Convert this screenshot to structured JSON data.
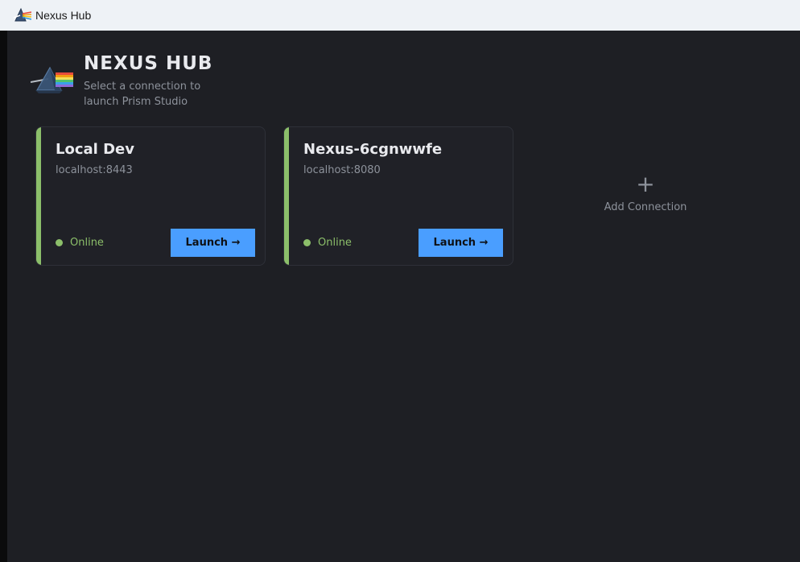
{
  "window": {
    "title": "Nexus Hub",
    "icon": "prism-app-icon"
  },
  "brand": {
    "title": "NEXUS HUB",
    "subtitle": "Select a connection to launch Prism Studio",
    "logo": "prism-logo"
  },
  "connections": [
    {
      "name": "Local Dev",
      "host": "localhost:8443",
      "status": "Online",
      "launch_label": "Launch →"
    },
    {
      "name": "Nexus-6cgnwwfe",
      "host": "localhost:8080",
      "status": "Online",
      "launch_label": "Launch →"
    }
  ],
  "add_connection": {
    "icon": "plus-icon",
    "label": "Add Connection"
  },
  "colors": {
    "background": "#1e1f24",
    "card": "#202127",
    "accent_online": "#8cbf6a",
    "launch_button": "#4a9eff",
    "titlebar": "#eef2f6"
  }
}
